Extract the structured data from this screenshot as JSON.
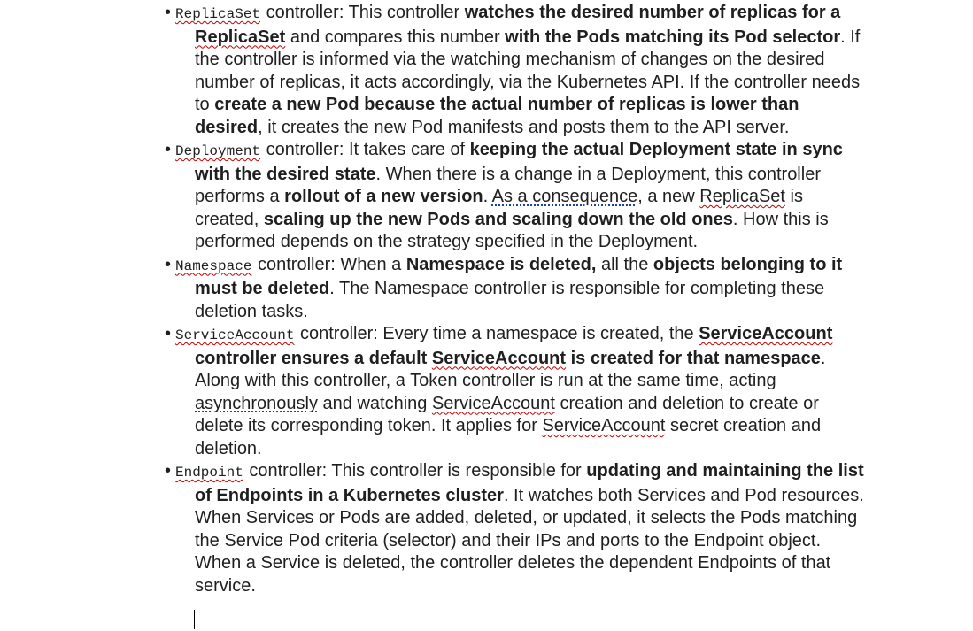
{
  "items": [
    {
      "code": "ReplicaSet",
      "parts": [
        {
          "t": " controller: This controller "
        },
        {
          "t": "watches the desired number of replicas for a ",
          "b": true
        },
        {
          "t": "ReplicaSet",
          "b": true,
          "u": "spell"
        },
        {
          "t": " and compares this number "
        },
        {
          "t": "with the Pods matching its Pod selector",
          "b": true
        },
        {
          "t": ". If the controller is informed via the watching mechanism of changes on the desired number of replicas, it acts accordingly, via the Kubernetes API. If the controller needs to "
        },
        {
          "t": "create a new Pod because the actual number of replicas is lower than desired",
          "b": true
        },
        {
          "t": ", it creates the new Pod manifests and posts them to the API server."
        }
      ]
    },
    {
      "code": "Deployment",
      "parts": [
        {
          "t": " controller: It takes care of "
        },
        {
          "t": "keeping the actual Deployment state in sync with the desired state",
          "b": true
        },
        {
          "t": ". When there is a change in a Deployment, this controller performs a "
        },
        {
          "t": "rollout of a new version",
          "b": true
        },
        {
          "t": ". "
        },
        {
          "t": "As a consequence",
          "u": "grammar"
        },
        {
          "t": ", a new "
        },
        {
          "t": "ReplicaSet",
          "u": "spell"
        },
        {
          "t": " is created, "
        },
        {
          "t": "scaling up the new Pods and scaling down the old ones",
          "b": true
        },
        {
          "t": ". How this is performed depends on the strategy specified in the Deployment."
        }
      ]
    },
    {
      "code": "Namespace",
      "parts": [
        {
          "t": " controller: When a "
        },
        {
          "t": "Namespace is deleted,",
          "b": true
        },
        {
          "t": " all the "
        },
        {
          "t": "objects belonging to it must be deleted",
          "b": true
        },
        {
          "t": ". The Namespace controller is responsible for completing these deletion tasks."
        }
      ]
    },
    {
      "code": "ServiceAccount",
      "parts": [
        {
          "t": " controller: Every time a namespace is created, the "
        },
        {
          "t": "ServiceAccount",
          "b": true,
          "u": "spell"
        },
        {
          "t": " controller ensures a default ",
          "b": true
        },
        {
          "t": "ServiceAccount",
          "b": true,
          "u": "spell"
        },
        {
          "t": " is created for that namespace",
          "b": true
        },
        {
          "t": ". Along with this controller, a Token controller is run at the same time, acting "
        },
        {
          "t": "asynchronously",
          "u": "grammar"
        },
        {
          "t": " and watching "
        },
        {
          "t": "ServiceAccount",
          "u": "spell"
        },
        {
          "t": " creation and deletion to create or delete its corresponding token. It applies for "
        },
        {
          "t": "ServiceAccount",
          "u": "spell"
        },
        {
          "t": " secret creation and deletion."
        }
      ]
    },
    {
      "code": "Endpoint",
      "parts": [
        {
          "t": " controller: This controller is responsible for "
        },
        {
          "t": "updating and maintaining the list of Endpoints in a Kubernetes cluster",
          "b": true
        },
        {
          "t": ". It watches both Services and Pod resources. When Services or Pods are added, deleted, or updated, it selects the Pods matching the Service Pod criteria (selector) and their IPs and ports to the Endpoint object. When a Service is deleted, the controller deletes the dependent Endpoints of that service."
        }
      ]
    }
  ],
  "bullet": "•"
}
